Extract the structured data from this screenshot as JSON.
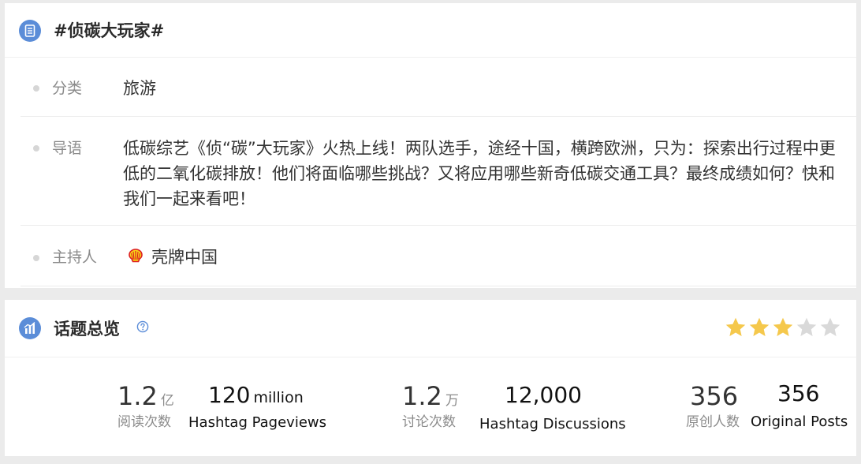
{
  "topic": {
    "title": "#侦碳大玩家#",
    "category_label": "分类",
    "category_value": "旅游",
    "intro_label": "导语",
    "intro_text": "低碳综艺《侦“碳”大玩家》火热上线！两队选手，途经十国，横跨欧洲，只为：探索出行过程中更低的二氧化碳排放！他们将面临哪些挑战？又将应用哪些新奇低碳交通工具？最终成绩如何？快和我们一起来看吧！",
    "host_label": "主持人",
    "host_name": "壳牌中国"
  },
  "overview": {
    "title": "话题总览",
    "rating_stars": 3,
    "rating_max": 5,
    "stats": [
      {
        "num": "1.2",
        "unit": "亿",
        "cn_label": "阅读次数",
        "en_num": "120",
        "en_unit": "million",
        "en_label": "Hashtag Pageviews"
      },
      {
        "num": "1.2",
        "unit": "万",
        "cn_label": "讨论次数",
        "en_num": "12,000",
        "en_unit": "",
        "en_label": "Hashtag Discussions"
      },
      {
        "num": "356",
        "unit": "",
        "cn_label": "原创人数",
        "en_num": "356",
        "en_unit": "",
        "en_label": "Original Posts"
      }
    ]
  },
  "colors": {
    "accent_blue": "#5b8dd8",
    "star_filled": "#f5c84c",
    "star_empty": "#d9d9d9",
    "page_bg": "#ebebeb"
  },
  "icons": {
    "topic_header": "document-list-icon",
    "overview_header": "bar-chart-icon",
    "help": "question-circle-icon",
    "host_logo": "shell-logo-icon"
  }
}
